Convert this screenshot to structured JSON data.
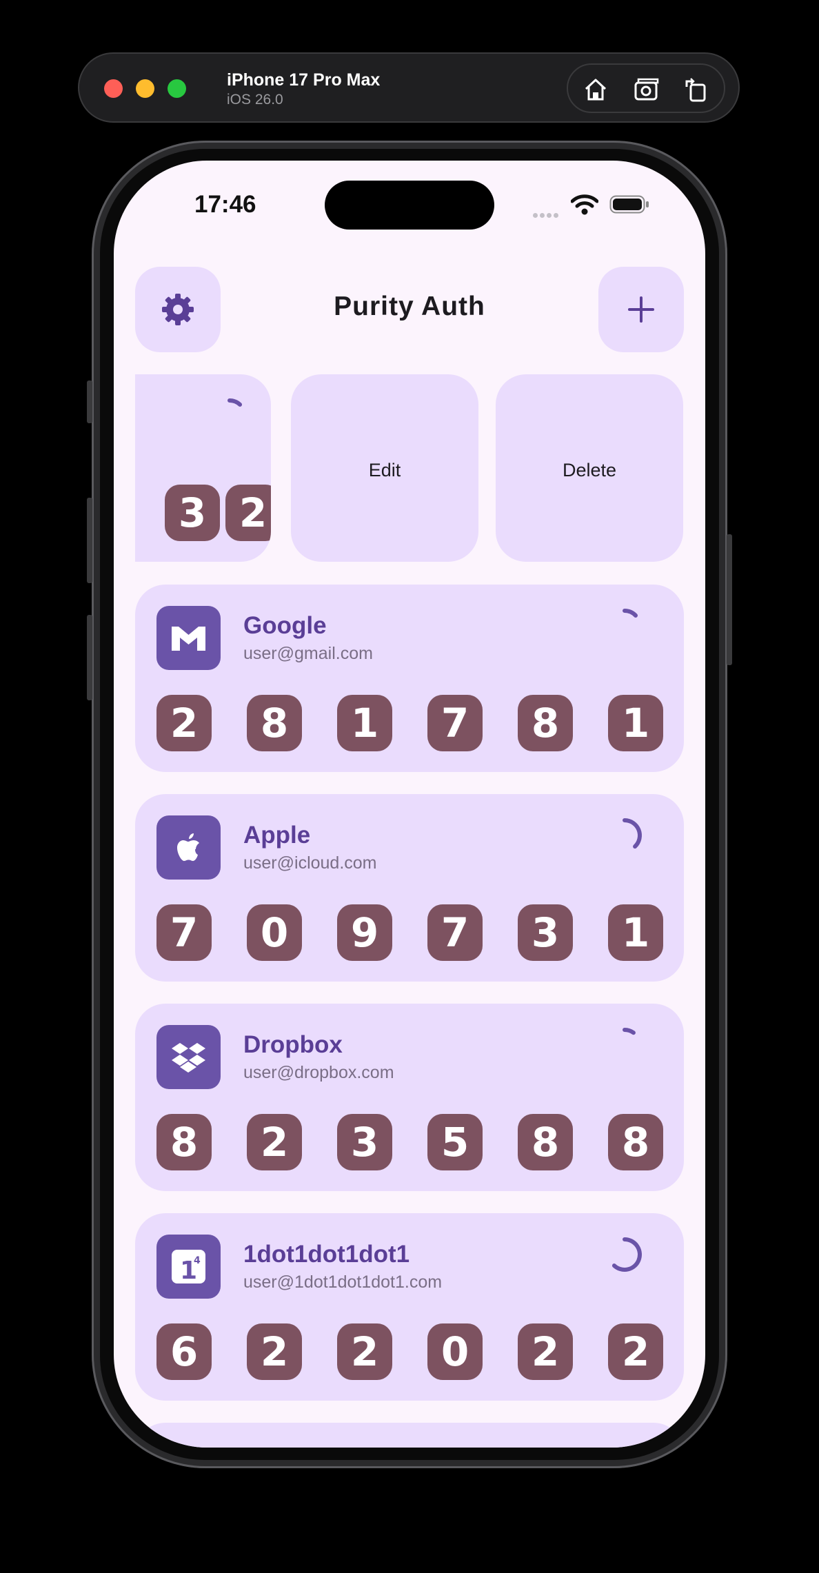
{
  "simulator": {
    "device_name": "iPhone 17 Pro Max",
    "os_version": "iOS 26.0",
    "tools": [
      "home-icon",
      "screenshot-icon",
      "rotate-icon"
    ]
  },
  "status_bar": {
    "time": "17:46"
  },
  "header": {
    "title": "Purity Auth",
    "settings_icon": "gear-icon",
    "add_icon": "plus-icon"
  },
  "swipe_row": {
    "peek_digits": [
      "3",
      "2"
    ],
    "timer_progress": 0.12,
    "actions": [
      {
        "label": "Edit"
      },
      {
        "label": "Delete"
      }
    ]
  },
  "accounts": [
    {
      "name": "Google",
      "user": "user@gmail.com",
      "icon": "gmail-icon",
      "digits": [
        "2",
        "8",
        "1",
        "7",
        "8",
        "1"
      ],
      "timer_progress": 0.13
    },
    {
      "name": "Apple",
      "user": "user@icloud.com",
      "icon": "apple-icon",
      "digits": [
        "7",
        "0",
        "9",
        "7",
        "3",
        "1"
      ],
      "timer_progress": 0.38
    },
    {
      "name": "Dropbox",
      "user": "user@dropbox.com",
      "icon": "dropbox-icon",
      "digits": [
        "8",
        "2",
        "3",
        "5",
        "8",
        "8"
      ],
      "timer_progress": 0.1
    },
    {
      "name": "1dot1dot1dot1",
      "user": "user@1dot1dot1dot1.com",
      "icon": "cloudflare-1111-icon",
      "digits": [
        "6",
        "2",
        "2",
        "0",
        "2",
        "2"
      ],
      "timer_progress": 0.62
    }
  ],
  "colors": {
    "screen_bg": "#fcf4fd",
    "card_bg": "#eadcfd",
    "accent": "#6a53a8",
    "digit_bg": "#7d5260",
    "title": "#5a3e96"
  }
}
